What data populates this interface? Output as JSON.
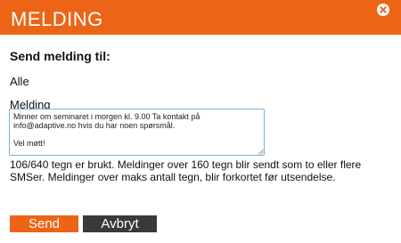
{
  "dialog": {
    "title": "MELDING"
  },
  "form": {
    "send_to_label": "Send melding til:",
    "recipients": "Alle",
    "message_label": "Melding",
    "message_value": "Minner om seminaret i morgen kl. 9.00 Ta kontakt på\ninfo@adaptive.no hvis du har noen spørsmål.\n\nVel møtt!",
    "counter_text": "106/640 tegn er brukt. Meldinger over 160 tegn blir sendt som to eller flere SMSer. Meldinger over maks antall tegn, blir forkortet før utsendelse."
  },
  "buttons": {
    "send_label": "Send",
    "cancel_label": "Avbryt"
  },
  "colors": {
    "accent": "#ec6516",
    "cancel_bg": "#3a3a3a",
    "input_border": "#7fb0d6"
  },
  "icons": {
    "close": "close-icon",
    "resize": "resize-grip-icon"
  }
}
